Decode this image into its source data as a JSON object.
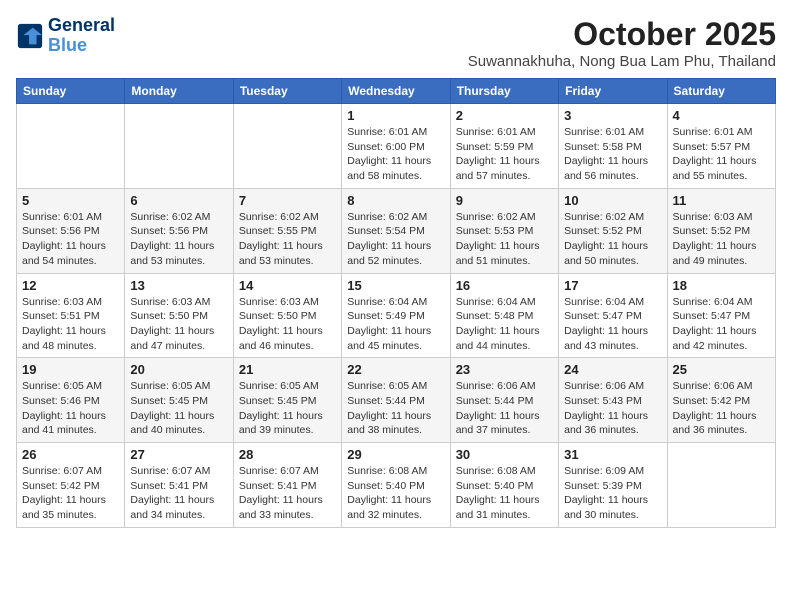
{
  "header": {
    "logo_line1": "General",
    "logo_line2": "Blue",
    "month_title": "October 2025",
    "subtitle": "Suwannakhuha, Nong Bua Lam Phu, Thailand"
  },
  "days_of_week": [
    "Sunday",
    "Monday",
    "Tuesday",
    "Wednesday",
    "Thursday",
    "Friday",
    "Saturday"
  ],
  "weeks": [
    [
      {
        "num": "",
        "sunrise": "",
        "sunset": "",
        "daylight": ""
      },
      {
        "num": "",
        "sunrise": "",
        "sunset": "",
        "daylight": ""
      },
      {
        "num": "",
        "sunrise": "",
        "sunset": "",
        "daylight": ""
      },
      {
        "num": "1",
        "sunrise": "Sunrise: 6:01 AM",
        "sunset": "Sunset: 6:00 PM",
        "daylight": "Daylight: 11 hours and 58 minutes."
      },
      {
        "num": "2",
        "sunrise": "Sunrise: 6:01 AM",
        "sunset": "Sunset: 5:59 PM",
        "daylight": "Daylight: 11 hours and 57 minutes."
      },
      {
        "num": "3",
        "sunrise": "Sunrise: 6:01 AM",
        "sunset": "Sunset: 5:58 PM",
        "daylight": "Daylight: 11 hours and 56 minutes."
      },
      {
        "num": "4",
        "sunrise": "Sunrise: 6:01 AM",
        "sunset": "Sunset: 5:57 PM",
        "daylight": "Daylight: 11 hours and 55 minutes."
      }
    ],
    [
      {
        "num": "5",
        "sunrise": "Sunrise: 6:01 AM",
        "sunset": "Sunset: 5:56 PM",
        "daylight": "Daylight: 11 hours and 54 minutes."
      },
      {
        "num": "6",
        "sunrise": "Sunrise: 6:02 AM",
        "sunset": "Sunset: 5:56 PM",
        "daylight": "Daylight: 11 hours and 53 minutes."
      },
      {
        "num": "7",
        "sunrise": "Sunrise: 6:02 AM",
        "sunset": "Sunset: 5:55 PM",
        "daylight": "Daylight: 11 hours and 53 minutes."
      },
      {
        "num": "8",
        "sunrise": "Sunrise: 6:02 AM",
        "sunset": "Sunset: 5:54 PM",
        "daylight": "Daylight: 11 hours and 52 minutes."
      },
      {
        "num": "9",
        "sunrise": "Sunrise: 6:02 AM",
        "sunset": "Sunset: 5:53 PM",
        "daylight": "Daylight: 11 hours and 51 minutes."
      },
      {
        "num": "10",
        "sunrise": "Sunrise: 6:02 AM",
        "sunset": "Sunset: 5:52 PM",
        "daylight": "Daylight: 11 hours and 50 minutes."
      },
      {
        "num": "11",
        "sunrise": "Sunrise: 6:03 AM",
        "sunset": "Sunset: 5:52 PM",
        "daylight": "Daylight: 11 hours and 49 minutes."
      }
    ],
    [
      {
        "num": "12",
        "sunrise": "Sunrise: 6:03 AM",
        "sunset": "Sunset: 5:51 PM",
        "daylight": "Daylight: 11 hours and 48 minutes."
      },
      {
        "num": "13",
        "sunrise": "Sunrise: 6:03 AM",
        "sunset": "Sunset: 5:50 PM",
        "daylight": "Daylight: 11 hours and 47 minutes."
      },
      {
        "num": "14",
        "sunrise": "Sunrise: 6:03 AM",
        "sunset": "Sunset: 5:50 PM",
        "daylight": "Daylight: 11 hours and 46 minutes."
      },
      {
        "num": "15",
        "sunrise": "Sunrise: 6:04 AM",
        "sunset": "Sunset: 5:49 PM",
        "daylight": "Daylight: 11 hours and 45 minutes."
      },
      {
        "num": "16",
        "sunrise": "Sunrise: 6:04 AM",
        "sunset": "Sunset: 5:48 PM",
        "daylight": "Daylight: 11 hours and 44 minutes."
      },
      {
        "num": "17",
        "sunrise": "Sunrise: 6:04 AM",
        "sunset": "Sunset: 5:47 PM",
        "daylight": "Daylight: 11 hours and 43 minutes."
      },
      {
        "num": "18",
        "sunrise": "Sunrise: 6:04 AM",
        "sunset": "Sunset: 5:47 PM",
        "daylight": "Daylight: 11 hours and 42 minutes."
      }
    ],
    [
      {
        "num": "19",
        "sunrise": "Sunrise: 6:05 AM",
        "sunset": "Sunset: 5:46 PM",
        "daylight": "Daylight: 11 hours and 41 minutes."
      },
      {
        "num": "20",
        "sunrise": "Sunrise: 6:05 AM",
        "sunset": "Sunset: 5:45 PM",
        "daylight": "Daylight: 11 hours and 40 minutes."
      },
      {
        "num": "21",
        "sunrise": "Sunrise: 6:05 AM",
        "sunset": "Sunset: 5:45 PM",
        "daylight": "Daylight: 11 hours and 39 minutes."
      },
      {
        "num": "22",
        "sunrise": "Sunrise: 6:05 AM",
        "sunset": "Sunset: 5:44 PM",
        "daylight": "Daylight: 11 hours and 38 minutes."
      },
      {
        "num": "23",
        "sunrise": "Sunrise: 6:06 AM",
        "sunset": "Sunset: 5:44 PM",
        "daylight": "Daylight: 11 hours and 37 minutes."
      },
      {
        "num": "24",
        "sunrise": "Sunrise: 6:06 AM",
        "sunset": "Sunset: 5:43 PM",
        "daylight": "Daylight: 11 hours and 36 minutes."
      },
      {
        "num": "25",
        "sunrise": "Sunrise: 6:06 AM",
        "sunset": "Sunset: 5:42 PM",
        "daylight": "Daylight: 11 hours and 36 minutes."
      }
    ],
    [
      {
        "num": "26",
        "sunrise": "Sunrise: 6:07 AM",
        "sunset": "Sunset: 5:42 PM",
        "daylight": "Daylight: 11 hours and 35 minutes."
      },
      {
        "num": "27",
        "sunrise": "Sunrise: 6:07 AM",
        "sunset": "Sunset: 5:41 PM",
        "daylight": "Daylight: 11 hours and 34 minutes."
      },
      {
        "num": "28",
        "sunrise": "Sunrise: 6:07 AM",
        "sunset": "Sunset: 5:41 PM",
        "daylight": "Daylight: 11 hours and 33 minutes."
      },
      {
        "num": "29",
        "sunrise": "Sunrise: 6:08 AM",
        "sunset": "Sunset: 5:40 PM",
        "daylight": "Daylight: 11 hours and 32 minutes."
      },
      {
        "num": "30",
        "sunrise": "Sunrise: 6:08 AM",
        "sunset": "Sunset: 5:40 PM",
        "daylight": "Daylight: 11 hours and 31 minutes."
      },
      {
        "num": "31",
        "sunrise": "Sunrise: 6:09 AM",
        "sunset": "Sunset: 5:39 PM",
        "daylight": "Daylight: 11 hours and 30 minutes."
      },
      {
        "num": "",
        "sunrise": "",
        "sunset": "",
        "daylight": ""
      }
    ]
  ]
}
